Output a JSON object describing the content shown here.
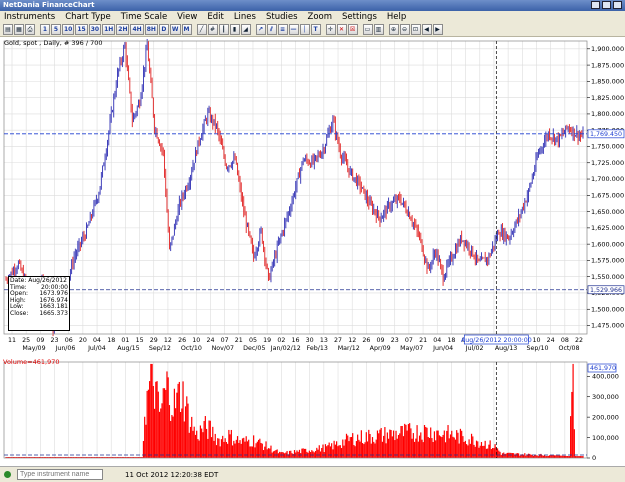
{
  "window": {
    "title": "NetDania FinanceChart"
  },
  "menu": [
    "Instruments",
    "Chart Type",
    "Time Scale",
    "View",
    "Edit",
    "Lines",
    "Studies",
    "Zoom",
    "Settings",
    "Help"
  ],
  "toolbar": {
    "periods": [
      "1",
      "5",
      "10",
      "15",
      "30",
      "1H",
      "2H",
      "4H",
      "8H",
      "D",
      "W",
      "M"
    ]
  },
  "chart": {
    "header": "Gold, spot , Daily, # 396 / 700",
    "price_ticks": [
      "1,900.000",
      "1,875.000",
      "1,850.000",
      "1,825.000",
      "1,800.000",
      "1,775.000",
      "1,750.000",
      "1,725.000",
      "1,700.000",
      "1,675.000",
      "1,650.000",
      "1,625.000",
      "1,600.000",
      "1,575.000",
      "1,550.000",
      "1,525.000",
      "1,500.000",
      "1,475.000"
    ],
    "crosshair_price_label": "1,769.450",
    "hline_price_label": "1,529.966",
    "date_ticks_upper": [
      "11",
      "25",
      "09",
      "23",
      "06",
      "20",
      "04",
      "18",
      "01",
      "15",
      "29",
      "12",
      "26",
      "10",
      "24",
      "07",
      "21",
      "05",
      "19",
      "02",
      "16",
      "30",
      "13",
      "27",
      "12",
      "26",
      "09",
      "23",
      "07",
      "21",
      "04",
      "18",
      "02",
      "16",
      "30",
      "13",
      "27",
      "10",
      "24",
      "08",
      "22"
    ],
    "date_ticks_lower": [
      "May/09",
      "Jun/06",
      "Jul/04",
      "Aug/15",
      "Sep/12",
      "Oct/10",
      "Nov/07",
      "Dec/05",
      "Jan/02/12",
      "Feb/13",
      "Mar/12",
      "Apr/09",
      "May/07",
      "Jun/04",
      "Jul/02",
      "Aug/13",
      "Sep/10",
      "Oct/08"
    ],
    "crosshair_date_label": "Aug/26/2012 20:00:00",
    "volume_label": "Volume=461,970",
    "volume_value_tag": "461,970",
    "volume_ticks": [
      "400,000",
      "300,000",
      "200,000",
      "100,000",
      "0"
    ]
  },
  "info_box": {
    "date": "Date: Aug/26/2012",
    "rows": [
      {
        "label": "Time:",
        "value": "20:00:00"
      },
      {
        "label": "Open:",
        "value": "1673.976"
      },
      {
        "label": "High:",
        "value": "1676.974"
      },
      {
        "label": "Low:",
        "value": "1663.181"
      },
      {
        "label": "Close:",
        "value": "1665.373"
      }
    ]
  },
  "status": {
    "search_placeholder": "Type instrument name",
    "timestamp": "11 Oct 2012 12:20:38 EDT"
  },
  "colors": {
    "up_bar": "#2d2db3",
    "down_bar": "#e02020",
    "volume": "#ff0000",
    "grid": "#dcdcdc",
    "crosshair": "#1f3fd0",
    "hline": "#203090"
  },
  "chart_data": {
    "type": "ohlc",
    "title": "Gold, spot , Daily, # 396 / 700",
    "ylim": [
      1462,
      1912
    ],
    "volume_ylim": [
      0,
      470000
    ],
    "price_path": [
      [
        0,
        1545
      ],
      [
        10,
        1570
      ],
      [
        20,
        1520
      ],
      [
        30,
        1550
      ],
      [
        38,
        1470
      ],
      [
        45,
        1510
      ],
      [
        55,
        1580
      ],
      [
        65,
        1620
      ],
      [
        75,
        1680
      ],
      [
        82,
        1760
      ],
      [
        90,
        1860
      ],
      [
        96,
        1905
      ],
      [
        102,
        1790
      ],
      [
        108,
        1820
      ],
      [
        114,
        1905
      ],
      [
        120,
        1780
      ],
      [
        127,
        1740
      ],
      [
        132,
        1590
      ],
      [
        140,
        1660
      ],
      [
        148,
        1700
      ],
      [
        156,
        1760
      ],
      [
        163,
        1800
      ],
      [
        170,
        1780
      ],
      [
        178,
        1720
      ],
      [
        185,
        1730
      ],
      [
        192,
        1650
      ],
      [
        200,
        1580
      ],
      [
        206,
        1620
      ],
      [
        212,
        1545
      ],
      [
        220,
        1600
      ],
      [
        230,
        1660
      ],
      [
        240,
        1730
      ],
      [
        248,
        1725
      ],
      [
        256,
        1745
      ],
      [
        264,
        1790
      ],
      [
        270,
        1740
      ],
      [
        278,
        1710
      ],
      [
        286,
        1690
      ],
      [
        294,
        1660
      ],
      [
        302,
        1640
      ],
      [
        310,
        1660
      ],
      [
        318,
        1670
      ],
      [
        326,
        1645
      ],
      [
        334,
        1610
      ],
      [
        341,
        1560
      ],
      [
        347,
        1590
      ],
      [
        353,
        1550
      ],
      [
        360,
        1580
      ],
      [
        368,
        1610
      ],
      [
        376,
        1590
      ],
      [
        382,
        1570
      ],
      [
        390,
        1580
      ],
      [
        398,
        1620
      ],
      [
        406,
        1610
      ],
      [
        414,
        1640
      ],
      [
        422,
        1680
      ],
      [
        430,
        1740
      ],
      [
        438,
        1770
      ],
      [
        446,
        1760
      ],
      [
        454,
        1780
      ],
      [
        460,
        1770
      ],
      [
        466,
        1765
      ]
    ],
    "volume_profile": [
      [
        0,
        0.01
      ],
      [
        110,
        0.01
      ],
      [
        112,
        0.5
      ],
      [
        118,
        0.95
      ],
      [
        124,
        0.5
      ],
      [
        130,
        0.8
      ],
      [
        136,
        0.6
      ],
      [
        142,
        0.75
      ],
      [
        148,
        0.45
      ],
      [
        154,
        0.25
      ],
      [
        160,
        0.35
      ],
      [
        166,
        0.3
      ],
      [
        172,
        0.2
      ],
      [
        180,
        0.25
      ],
      [
        190,
        0.18
      ],
      [
        200,
        0.2
      ],
      [
        212,
        0.12
      ],
      [
        222,
        0.05
      ],
      [
        240,
        0.08
      ],
      [
        260,
        0.12
      ],
      [
        280,
        0.22
      ],
      [
        300,
        0.25
      ],
      [
        320,
        0.28
      ],
      [
        340,
        0.3
      ],
      [
        360,
        0.26
      ],
      [
        380,
        0.2
      ],
      [
        396,
        0.12
      ],
      [
        400,
        0.05
      ],
      [
        420,
        0.04
      ],
      [
        440,
        0.03
      ],
      [
        455,
        0.02
      ],
      [
        458,
        1.0
      ],
      [
        460,
        0.02
      ]
    ]
  }
}
